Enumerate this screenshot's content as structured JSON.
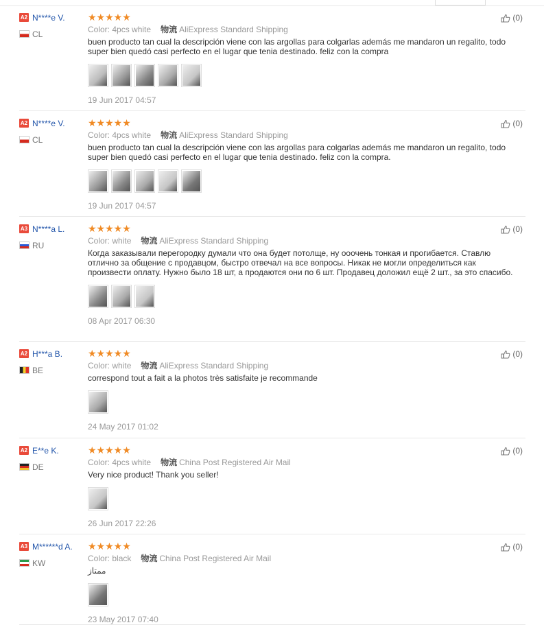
{
  "colors": {
    "accent_red": "#e94a3a",
    "star_orange": "#f08a24",
    "name_blue": "#2255aa"
  },
  "icons": {
    "like": "thumbs-up-icon",
    "star": "star-icon"
  },
  "labels": {
    "color": "Color:",
    "shipping_zh": "物流"
  },
  "reviews": [
    {
      "level": "A2",
      "name": "N****e V.",
      "country": "CL",
      "stars": "★★★★★",
      "color_value": "4pcs white",
      "shipping": "AliExpress Standard Shipping",
      "text": "buen producto tan cual la descripción viene con las argollas para colgarlas además me mandaron un regalito, todo super bien quedó casi perfecto en el lugar que tenia destinado. feliz con la compra",
      "photo_count": 5,
      "date": "19 Jun 2017 04:57",
      "likes": "(0)"
    },
    {
      "level": "A2",
      "name": "N****e V.",
      "country": "CL",
      "stars": "★★★★★",
      "color_value": "4pcs white",
      "shipping": "AliExpress Standard Shipping",
      "text": "buen producto tan cual la descripción viene con las argollas para colgarlas además me mandaron un regalito, todo super bien quedó casi perfecto en el lugar que tenia destinado. feliz con la compra.",
      "photo_count": 5,
      "date": "19 Jun 2017 04:57",
      "likes": "(0)"
    },
    {
      "level": "A3",
      "name": "N****a L.",
      "country": "RU",
      "stars": "★★★★★",
      "color_value": "white",
      "shipping": "AliExpress Standard Shipping",
      "text": "Когда заказывали перегородку думали что она будет потолще, ну ооочень тонкая и прогибается. Ставлю отлично за общение с продавцом, быстро отвечал на все вопросы. Никак не могли определиться как произвести оплату. Нужно было 18 шт, а продаются они по 6 шт. Продавец доложил ещё 2 шт., за это спасибо.",
      "photo_count": 3,
      "date": "08 Apr 2017 06:30",
      "likes": "(0)"
    },
    {
      "level": "A2",
      "name": "H***a B.",
      "country": "BE",
      "stars": "★★★★★",
      "color_value": "white",
      "shipping": "AliExpress Standard Shipping",
      "text": "correspond tout a fait a la photos très satisfaite je recommande",
      "photo_count": 1,
      "date": "24 May 2017 01:02",
      "likes": "(0)"
    },
    {
      "level": "A2",
      "name": "E**e K.",
      "country": "DE",
      "stars": "★★★★★",
      "color_value": "4pcs white",
      "shipping": "China Post Registered Air Mail",
      "text": "Very nice product! Thank you seller!",
      "photo_count": 1,
      "date": "26 Jun 2017 22:26",
      "likes": "(0)"
    },
    {
      "level": "A3",
      "name": "M******d A.",
      "country": "KW",
      "stars": "★★★★★",
      "color_value": "black",
      "shipping": "China Post Registered Air Mail",
      "text": "ممتاز",
      "photo_count": 1,
      "date": "23 May 2017 07:40",
      "likes": "(0)"
    }
  ]
}
